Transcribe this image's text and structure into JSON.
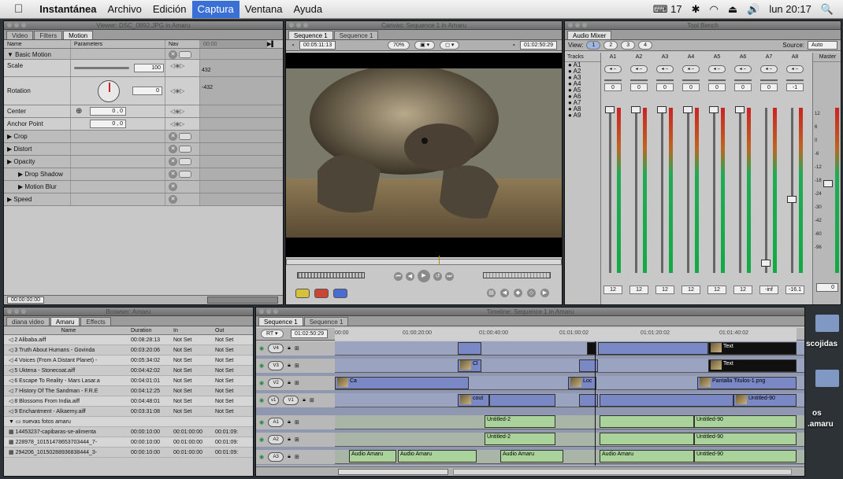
{
  "menubar": {
    "app": "Instantánea",
    "items": [
      "Archivo",
      "Edición",
      "Captura",
      "Ventana",
      "Ayuda"
    ],
    "active_index": 2,
    "status": {
      "input": "17",
      "clock": "lun 20:17"
    }
  },
  "viewer": {
    "title": "Viewer: DSC_0892.JPG in Amaru",
    "tabs": [
      "Video",
      "Filters",
      "Motion"
    ],
    "active_tab": "Motion",
    "columns": {
      "name": "Name",
      "params": "Parameters",
      "nav": "Nav",
      "time": "00:00"
    },
    "rows": [
      {
        "name": "Basic Motion",
        "section": true,
        "value": ""
      },
      {
        "name": "Scale",
        "section": false,
        "value": "100"
      },
      {
        "name": "Rotation",
        "section": false,
        "value": "0"
      },
      {
        "name": "Center",
        "section": false,
        "value": "0 ,      0"
      },
      {
        "name": "Anchor Point",
        "section": false,
        "value": "0 ,      0"
      },
      {
        "name": "Crop",
        "section": true,
        "value": ""
      },
      {
        "name": "Distort",
        "section": true,
        "value": ""
      },
      {
        "name": "Opacity",
        "section": true,
        "value": ""
      },
      {
        "name": "Drop Shadow",
        "section": true,
        "value": ""
      },
      {
        "name": "Motion Blur",
        "section": true,
        "value": ""
      },
      {
        "name": "Speed",
        "section": true,
        "value": ""
      }
    ],
    "rotation_marks": {
      "top": "432",
      "bottom": "-432"
    },
    "timecode": "00:00:00:00"
  },
  "canvas": {
    "title": "Canvas: Sequence 1 in Amaru",
    "tabs": [
      "Sequence 1",
      "Sequence 1"
    ],
    "timecode_left": "00:05:11:13",
    "zoom": "70%",
    "timecode_right": "01:02:50:29"
  },
  "mixer": {
    "title": "Tool Bench",
    "tab": "Audio Mixer",
    "view_label": "View:",
    "views": [
      "1",
      "2",
      "3",
      "4"
    ],
    "source_label": "Source:",
    "source_value": "Auto",
    "tracks_label": "Tracks",
    "track_list": [
      "A1",
      "A2",
      "A3",
      "A4",
      "A5",
      "A6",
      "A7",
      "A8",
      "A9"
    ],
    "strips": [
      "A1",
      "A2",
      "A3",
      "A4",
      "A5",
      "A6",
      "A7",
      "A8"
    ],
    "master_label": "Master",
    "pan_values": [
      "0",
      "0",
      "0",
      "0",
      "0",
      "0",
      "0",
      "-1"
    ],
    "levels": [
      "12",
      "12",
      "12",
      "12",
      "12",
      "12",
      "-inf",
      "-16.1"
    ],
    "master_level": "0",
    "scale": [
      "12",
      "6",
      "0",
      "-6",
      "-12",
      "-18",
      "-24",
      "-30",
      "-42",
      "-60",
      "-96"
    ]
  },
  "browser": {
    "title": "Browser: Amaru",
    "tabs": [
      "diana video",
      "Amaru",
      "Effects"
    ],
    "columns": [
      "Name",
      "Duration",
      "In",
      "Out"
    ],
    "rows": [
      {
        "name": "2 Alibaba.aiff",
        "dur": "00:08:28:13",
        "in": "Not Set",
        "out": "Not Set"
      },
      {
        "name": "3 Truth About Humans - Govinda",
        "dur": "00:03:20:06",
        "in": "Not Set",
        "out": "Not Set"
      },
      {
        "name": "4 Voices (From A Distant Planet) -",
        "dur": "00:05:34:02",
        "in": "Not Set",
        "out": "Not Set"
      },
      {
        "name": "5 Uktena - Stonecoat.aiff",
        "dur": "00:04:42:02",
        "in": "Not Set",
        "out": "Not Set"
      },
      {
        "name": "6 Escape To Reality - Mars Lasar.a",
        "dur": "00:04:01:01",
        "in": "Not Set",
        "out": "Not Set"
      },
      {
        "name": "7 History Of The Sandman - F.R.E",
        "dur": "00:04:12:25",
        "in": "Not Set",
        "out": "Not Set"
      },
      {
        "name": "8 Blossoms From India.aiff",
        "dur": "00:04:48:01",
        "in": "Not Set",
        "out": "Not Set"
      },
      {
        "name": "9 Enchantment - Alkaemy.aiff",
        "dur": "00:03:31:08",
        "in": "Not Set",
        "out": "Not Set"
      },
      {
        "name": "nuevas fotos amaru",
        "dur": "",
        "in": "",
        "out": ""
      },
      {
        "name": "14453237-capibaras-se-alimenta",
        "dur": "00:00:10:00",
        "in": "00:01:00:00",
        "out": "00:01:09:"
      },
      {
        "name": "228978_10151478653703444_7-",
        "dur": "00:00:10:00",
        "in": "00:01:00:00",
        "out": "00:01:09:"
      },
      {
        "name": "294206_10150288936838444_3-",
        "dur": "00:00:10:00",
        "in": "00:01:00:00",
        "out": "00:01:09:"
      }
    ]
  },
  "timeline": {
    "title": "Timeline: Sequence 1 in Amaru",
    "tabs": [
      "Sequence 1",
      "Sequence 1"
    ],
    "rt": "RT",
    "timecode": "01:02:50:29",
    "ruler": [
      "00:00",
      "01:00:20:00",
      "01:00:40:00",
      "01:01:00:02",
      "01:01:20:02",
      "01:01:40:02"
    ],
    "video_tracks": [
      "V4",
      "V3",
      "V2",
      "V1"
    ],
    "v1_src": "v1",
    "audio_tracks": [
      "A1",
      "A2",
      "A3"
    ],
    "clips": {
      "text1": "Text",
      "text2": "Text",
      "pantalla": "Pantalla Titulos-1.png",
      "untitled90": "Untitled-90",
      "untitled2": "Untitled-2",
      "audio_amaru": "Audio Amaru",
      "cout": "cout",
      "loc": "Loc",
      "ca": "Ca",
      "cl": "Cl"
    }
  },
  "desktop": {
    "items": [
      "scojidas",
      "os",
      ".amaru"
    ]
  }
}
